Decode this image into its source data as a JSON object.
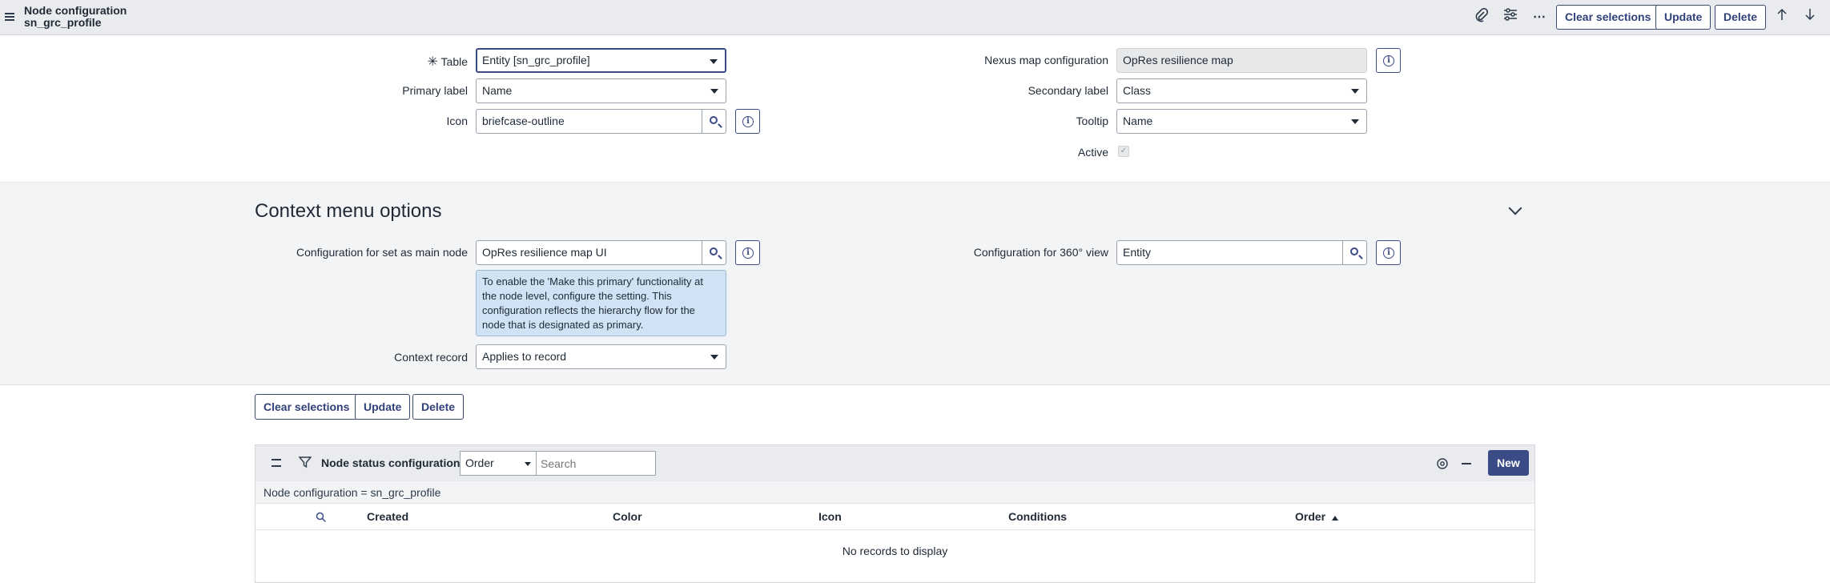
{
  "header": {
    "title_line1": "Node configuration",
    "title_line2": "sn_grc_profile",
    "clear_label": "Clear selections",
    "update_label": "Update",
    "delete_label": "Delete"
  },
  "form": {
    "table_label": "Table",
    "table_value": "Entity [sn_grc_profile]",
    "primary_label": "Primary label",
    "primary_value": "Name",
    "icon_label": "Icon",
    "icon_value": "briefcase-outline",
    "nexus_label": "Nexus map configuration",
    "nexus_value": "OpRes resilience map",
    "secondary_label": "Secondary label",
    "secondary_value": "Class",
    "tooltip_label": "Tooltip",
    "tooltip_value": "Name",
    "active_label": "Active"
  },
  "context": {
    "title": "Context menu options",
    "main_node_label": "Configuration for set as main node",
    "main_node_value": "OpRes resilience map UI",
    "info_text": "To enable the 'Make this primary' functionality at the node level, configure the setting. This configuration reflects the hierarchy flow for the node that is designated as primary.",
    "view360_label": "Configuration for 360° view",
    "view360_value": "Entity",
    "context_record_label": "Context record",
    "context_record_value": "Applies to record"
  },
  "bottom_buttons": {
    "clear_label": "Clear selections",
    "update_label": "Update",
    "delete_label": "Delete"
  },
  "related_list": {
    "title": "Node status configurations",
    "select_value": "Order",
    "search_placeholder": "Search",
    "new_label": "New",
    "filter_text": "Node configuration = sn_grc_profile",
    "columns": [
      "Created",
      "Color",
      "Icon",
      "Conditions",
      "Order"
    ],
    "empty_text": "No records to display"
  }
}
